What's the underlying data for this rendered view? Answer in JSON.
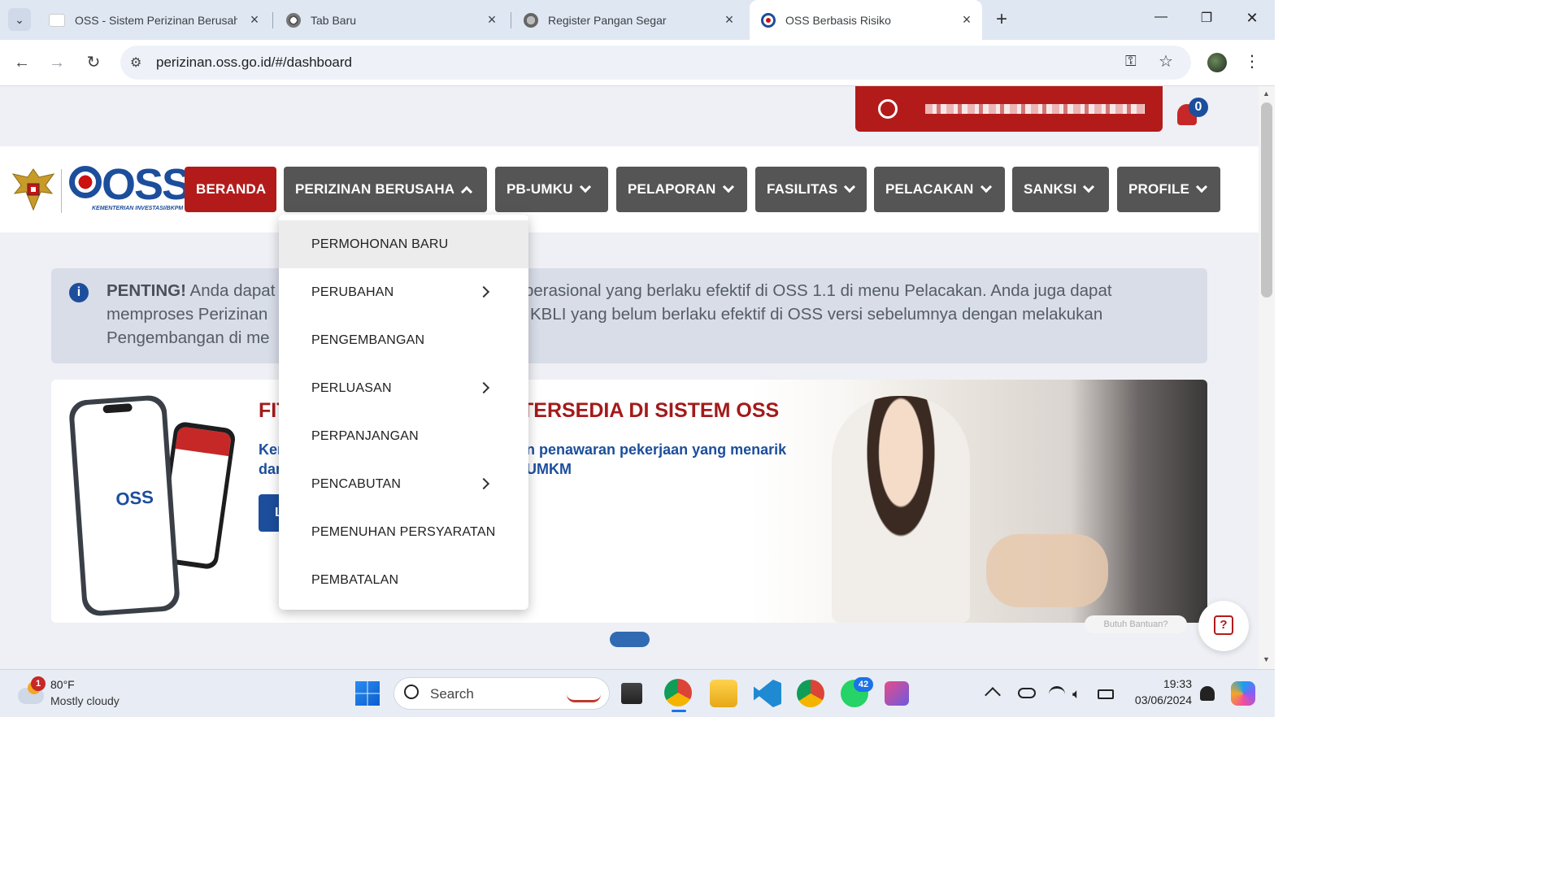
{
  "browser": {
    "tabs": [
      {
        "title": "OSS - Sistem Perizinan Berusaha",
        "icon": "oss-favicon"
      },
      {
        "title": "Tab Baru",
        "icon": "chrome-icon"
      },
      {
        "title": "Register Pangan Segar",
        "icon": "globe-icon"
      },
      {
        "title": "OSS Berbasis Risiko",
        "icon": "oss-logo-icon"
      }
    ],
    "new_tab": "+",
    "url": "perizinan.oss.go.id/#/dashboard",
    "window_controls": {
      "minimize": "—",
      "restore": "❐",
      "close": "✕"
    }
  },
  "header": {
    "notification_count": "0",
    "logo_text": "OSS",
    "logo_sub": "KEMENTERIAN INVESTASI/BKPM"
  },
  "nav": {
    "items": [
      {
        "label": "BERANDA"
      },
      {
        "label": "PERIZINAN BERUSAHA"
      },
      {
        "label": "PB-UMKU"
      },
      {
        "label": "PELAPORAN"
      },
      {
        "label": "FASILITAS"
      },
      {
        "label": "PELACAKAN"
      },
      {
        "label": "SANKSI"
      },
      {
        "label": "PROFILE"
      }
    ]
  },
  "dropdown": {
    "items": [
      {
        "label": "PERMOHONAN BARU"
      },
      {
        "label": "PERUBAHAN"
      },
      {
        "label": "PENGEMBANGAN"
      },
      {
        "label": "PERLUASAN"
      },
      {
        "label": "PERPANJANGAN"
      },
      {
        "label": "PENCABUTAN"
      },
      {
        "label": "PEMENUHAN PERSYARATAN"
      },
      {
        "label": "PEMBATALAN"
      }
    ]
  },
  "notice": {
    "bold": "PENTING!",
    "line1a": " Anda dapat",
    "line1b": "perasional yang berlaku efektif di OSS 1.1 di menu Pelacakan. Anda juga dapat",
    "line2a": "memproses Perizinan",
    "line2b": "KBLI yang belum berlaku efektif di OSS versi sebelumnya dengan melakukan",
    "line3a": "Pengembangan di me"
  },
  "banner": {
    "title_a": "FIT",
    "title_b": "TERSEDIA DI SISTEM OSS",
    "sub1a": "Ker",
    "sub1b": "n penawaran pekerjaan yang menarik",
    "sub2a": "dar",
    "sub2b": "UMKM",
    "btn": "L",
    "phone_logo": "OSS"
  },
  "help": {
    "label": "Butuh Bantuan?",
    "icon": "?"
  },
  "taskbar": {
    "weather_temp": "80°F",
    "weather_desc": "Mostly cloudy",
    "weather_badge": "1",
    "search": "Search",
    "whatsapp_badge": "42",
    "time": "19:33",
    "date": "03/06/2024"
  },
  "colors": {
    "brand_red": "#b31b1b",
    "menu_grey": "#555555",
    "accent_blue": "#1c4e9c"
  }
}
